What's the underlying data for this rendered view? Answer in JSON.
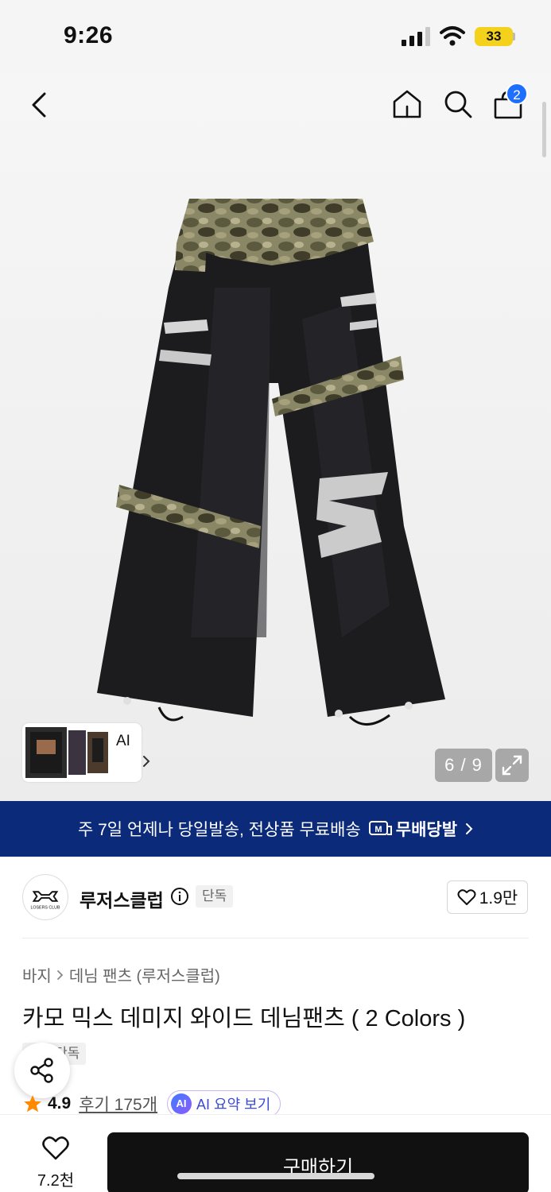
{
  "status_bar": {
    "time": "9:26",
    "battery": "33",
    "icons": [
      "signal-icon",
      "wifi-icon",
      "battery-icon"
    ]
  },
  "nav": {
    "icons": [
      "back-icon",
      "home-icon",
      "search-icon",
      "cart-icon"
    ],
    "cart_count": "2"
  },
  "gallery": {
    "thumb_label": "AI",
    "counter": "6 / 9",
    "expand_icon": "expand-icon"
  },
  "delivery": {
    "text": "주 7일 언제나 당일발송, 전상품 무료배송",
    "badge": "무배당발",
    "badge_icon": "delivery-truck-icon"
  },
  "brand": {
    "name": "루저스클럽",
    "badge": "단독",
    "likes": "1.9만",
    "logo_text": "LOSERS CLUB"
  },
  "product": {
    "breadcrumb": [
      "바지",
      "데님 팬츠 (루저스클럽)"
    ],
    "title": "카모 믹스 데미지 와이드 데님팬츠 ( 2 Colors )",
    "tag": "단독",
    "rating": "4.9",
    "reviews": "후기 175개",
    "ai_summary": "AI 요약 보기",
    "ai_badge": "AI"
  },
  "bottom": {
    "wish_count": "7.2천",
    "buy_label": "구매하기"
  },
  "colors": {
    "banner": "#0b2a7a",
    "badge_blue": "#1f6fff",
    "star": "#ff8a00",
    "buy": "#111111"
  }
}
